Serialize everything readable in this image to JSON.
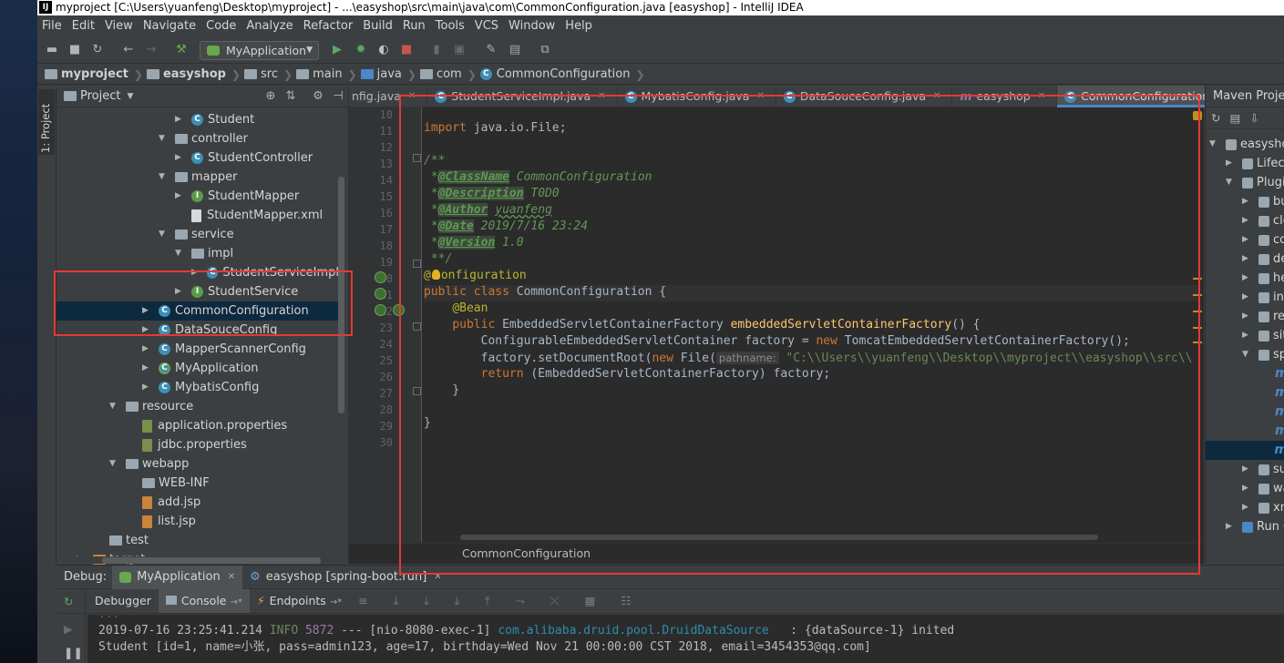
{
  "window": {
    "title": "myproject [C:\\Users\\yuanfeng\\Desktop\\myproject] - ...\\easyshop\\src\\main\\java\\com\\CommonConfiguration.java [easyshop] - IntelliJ IDEA",
    "logo_text": "IJ"
  },
  "menu": [
    "File",
    "Edit",
    "View",
    "Navigate",
    "Code",
    "Analyze",
    "Refactor",
    "Build",
    "Run",
    "Tools",
    "VCS",
    "Window",
    "Help"
  ],
  "toolbar": {
    "run_config": "MyApplication"
  },
  "breadcrumb": [
    "myproject",
    "easyshop",
    "src",
    "main",
    "java",
    "com",
    "CommonConfiguration"
  ],
  "left_strip": {
    "project_tab": "1: Project"
  },
  "project_panel": {
    "title": "Project",
    "tree": [
      {
        "label": "Student",
        "kind": "class",
        "arrow": "▶"
      },
      {
        "label": "controller",
        "kind": "folder",
        "arrow": "▼"
      },
      {
        "label": "StudentController",
        "kind": "class",
        "arrow": "▶"
      },
      {
        "label": "mapper",
        "kind": "folder",
        "arrow": "▼"
      },
      {
        "label": "StudentMapper",
        "kind": "interface",
        "arrow": "▶"
      },
      {
        "label": "StudentMapper.xml",
        "kind": "xml",
        "arrow": ""
      },
      {
        "label": "service",
        "kind": "folder",
        "arrow": "▼"
      },
      {
        "label": "impl",
        "kind": "folder",
        "arrow": "▼"
      },
      {
        "label": "StudentServiceImpl",
        "kind": "class",
        "arrow": "▶"
      },
      {
        "label": "StudentService",
        "kind": "interface",
        "arrow": "▶"
      },
      {
        "label": "CommonConfiguration",
        "kind": "class",
        "arrow": "▶"
      },
      {
        "label": "DataSouceConfig",
        "kind": "class",
        "arrow": "▶"
      },
      {
        "label": "MapperScannerConfig",
        "kind": "class",
        "arrow": "▶"
      },
      {
        "label": "MyApplication",
        "kind": "spring",
        "arrow": "▶"
      },
      {
        "label": "MybatisConfig",
        "kind": "class",
        "arrow": "▶"
      },
      {
        "label": "resource",
        "kind": "folder",
        "arrow": "▼"
      },
      {
        "label": "application.properties",
        "kind": "props",
        "arrow": ""
      },
      {
        "label": "jdbc.properties",
        "kind": "props",
        "arrow": ""
      },
      {
        "label": "webapp",
        "kind": "folder",
        "arrow": "▼"
      },
      {
        "label": "WEB-INF",
        "kind": "folder",
        "arrow": ""
      },
      {
        "label": "add.jsp",
        "kind": "jsp",
        "arrow": ""
      },
      {
        "label": "list.jsp",
        "kind": "jsp",
        "arrow": ""
      },
      {
        "label": "test",
        "kind": "folder",
        "arrow": ""
      },
      {
        "label": "target",
        "kind": "folder-orange",
        "arrow": "▶"
      }
    ]
  },
  "editor": {
    "tabs": [
      {
        "label": "nfig.java",
        "icon": ""
      },
      {
        "label": "StudentServiceImpl.java",
        "icon": "class"
      },
      {
        "label": "MybatisConfig.java",
        "icon": "class"
      },
      {
        "label": "DataSouceConfig.java",
        "icon": "class"
      },
      {
        "label": "easyshop",
        "icon": "m"
      },
      {
        "label": "CommonConfiguration.java",
        "icon": "class"
      }
    ],
    "tabs_overflow": "≡",
    "line_numbers": [
      "10",
      "11",
      "12",
      "13",
      "14",
      "15",
      "16",
      "17",
      "18",
      "19",
      "20",
      "21",
      "22",
      "23",
      "24",
      "25",
      "26",
      "27",
      "28",
      "29",
      "30"
    ],
    "code": {
      "l11_kw": "import",
      "l11_rest": " java.io.File;",
      "l13": "/**",
      "l14_tag": "@ClassName",
      "l14_val": " CommonConfiguration",
      "l15_tag": "@Description",
      "l15_val": " T0D0",
      "l16_tag": "@Author",
      "l16_val": "yuanfeng",
      "l17_tag": "@Date",
      "l17_val": " 2019/7/16 23:24",
      "l18_tag": "@Version",
      "l18_val": " 1.0",
      "l19": " **/",
      "l20_at": "@",
      "l20_ann": "onfiguration",
      "l21_kw": "public class",
      "l21_rest": " CommonConfiguration {",
      "l22_ann": "@Bean",
      "l23_kw": "public",
      "l23_type": " EmbeddedServletContainerFactory ",
      "l23_fn": "embeddedServletContainerFactory",
      "l23_rest": "() {",
      "l24_pre": "ConfigurableEmbeddedServletContainer factory = ",
      "l24_kw": "new",
      "l24_rest": " TomcatEmbeddedServletContainerFactory();",
      "l25_pre": "factory.setDocumentRoot(",
      "l25_kw": "new",
      "l25_mid": " File(",
      "l25_hint": "pathname:",
      "l25_str": " \"C:\\\\Users\\\\yuanfeng\\\\Desktop\\\\myproject\\\\easyshop\\\\src\\\\",
      "l26_kw": "return",
      "l26_rest": " (EmbeddedServletContainerFactory) factory;",
      "l27": "}",
      "l29": "}"
    },
    "bottom_breadcrumb": "CommonConfiguration"
  },
  "maven_panel": {
    "title": "Maven Projects",
    "rows": [
      {
        "label": "easyshop",
        "arrow": "▼"
      },
      {
        "label": "Lifecycle",
        "arrow": "▶"
      },
      {
        "label": "Plugins",
        "arrow": "▼"
      },
      {
        "label": "build",
        "arrow": "▶"
      },
      {
        "label": "clean",
        "arrow": "▶"
      },
      {
        "label": "compiler",
        "arrow": "▶"
      },
      {
        "label": "deploy",
        "arrow": "▶"
      },
      {
        "label": "help",
        "arrow": "▶"
      },
      {
        "label": "install",
        "arrow": "▶"
      },
      {
        "label": "resources",
        "arrow": "▶"
      },
      {
        "label": "site",
        "arrow": "▶"
      },
      {
        "label": "spring-boot",
        "arrow": "▼"
      },
      {
        "label": "",
        "arrow": ""
      },
      {
        "label": "",
        "arrow": ""
      },
      {
        "label": "",
        "arrow": ""
      },
      {
        "label": "",
        "arrow": ""
      },
      {
        "label": "",
        "arrow": ""
      },
      {
        "label": "surefire",
        "arrow": "▶"
      },
      {
        "label": "war",
        "arrow": "▶"
      },
      {
        "label": "xml",
        "arrow": "▶"
      },
      {
        "label": "Run Configurations",
        "arrow": "▶"
      }
    ]
  },
  "debug": {
    "label": "Debug:",
    "tabs": [
      "MyApplication",
      "easyshop [spring-boot:run]"
    ],
    "subtabs": [
      "Debugger",
      "Console",
      "Endpoints"
    ],
    "console": [
      {
        "ts": "2019-07-16 23:25:41.214",
        "level": "INFO",
        "pid": "5872",
        "thread": " --- [nio-8080-exec-1] ",
        "logger": "com.alibaba.druid.pool.DruidDataSource",
        "msg": "   : {dataSource-1} inited"
      },
      {
        "text": "Student [id=1, name=小张, pass=admin123, age=17, birthday=Wed Nov 21 00:00:00 CST 2018, email=3454353@qq.com]"
      }
    ]
  }
}
